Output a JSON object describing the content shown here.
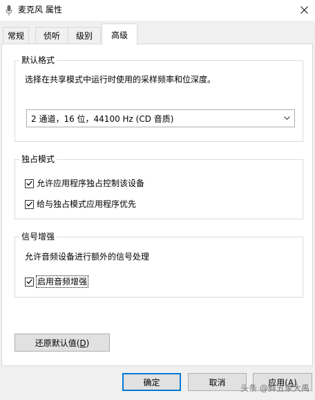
{
  "window": {
    "title": "麦克风 属性",
    "icon": "microphone-icon"
  },
  "tabs": [
    {
      "label": "常规",
      "active": false
    },
    {
      "label": "侦听",
      "active": false
    },
    {
      "label": "级别",
      "active": false
    },
    {
      "label": "高级",
      "active": true
    }
  ],
  "default_format": {
    "title": "默认格式",
    "description": "选择在共享模式中运行时使用的采样频率和位深度。",
    "selected": "2 通道，16 位，44100 Hz (CD 音质)"
  },
  "exclusive_mode": {
    "title": "独占模式",
    "options": [
      {
        "label": "允许应用程序独占控制该设备",
        "checked": true
      },
      {
        "label": "给与独占模式应用程序优先",
        "checked": true
      }
    ]
  },
  "signal_enhancement": {
    "title": "信号增强",
    "description": "允许音频设备进行额外的信号处理",
    "option": {
      "label": "启用音频增强",
      "checked": true
    }
  },
  "restore_defaults": {
    "label_main": "还原默认值(",
    "accel": "D",
    "label_end": ")"
  },
  "footer": {
    "ok": "确定",
    "cancel": "取消",
    "apply_main": "应用(",
    "apply_accel": "A",
    "apply_end": ")"
  },
  "watermark": "头条 @鲜五家大禹"
}
